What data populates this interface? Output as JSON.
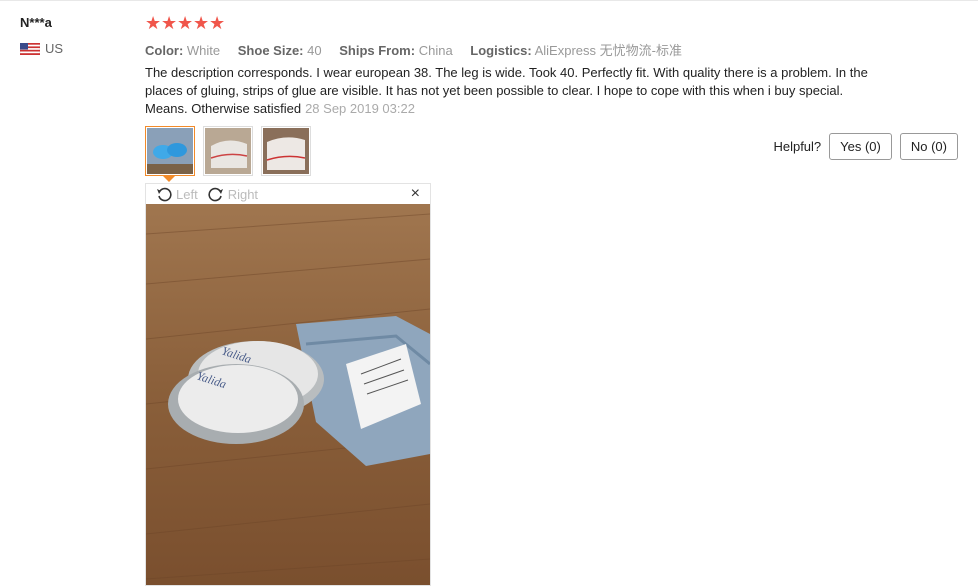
{
  "reviewer": {
    "name": "N***a",
    "country": "US"
  },
  "rating": {
    "stars": 5,
    "max": 5
  },
  "attributes": [
    {
      "key": "Color:",
      "value": "White"
    },
    {
      "key": "Shoe Size:",
      "value": "40"
    },
    {
      "key": "Ships From:",
      "value": "China"
    },
    {
      "key": "Logistics:",
      "value": "AliExpress 无忧物流-标准"
    }
  ],
  "review": {
    "text": "The description corresponds. I wear european 38. The leg is wide. Took 40. Perfectly fit. With quality there is a problem. In the places of gluing, strips of glue are visible. It has not yet been possible to clear. I hope to cope with this when i buy special. Means. Otherwise satisfied",
    "date": "28 Sep 2019 03:22"
  },
  "helpful": {
    "label": "Helpful?",
    "yes": "Yes (0)",
    "no": "No (0)"
  },
  "viewer": {
    "rotate_left": "Left",
    "rotate_right": "Right",
    "close": "×"
  },
  "colors": {
    "star": "#f0564b",
    "active_thumb": "#f28b2a"
  }
}
